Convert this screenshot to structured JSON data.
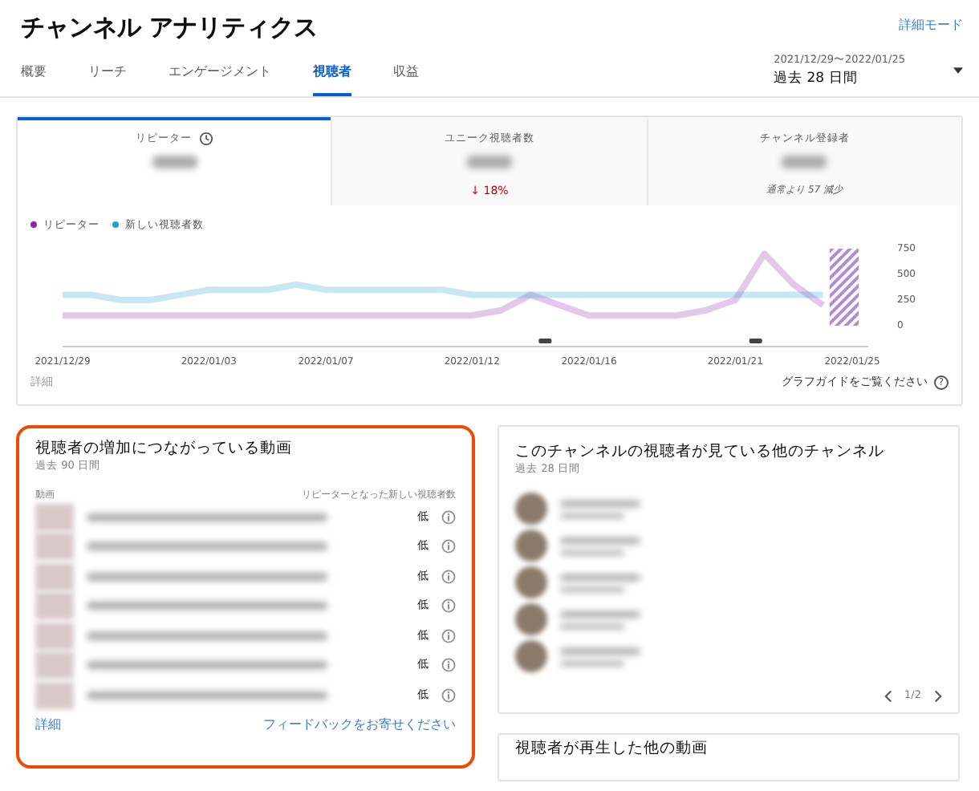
{
  "header": {
    "title": "チャンネル アナリティクス",
    "advanced_mode": "詳細モード"
  },
  "tabs": [
    {
      "label": "概要",
      "selected": false
    },
    {
      "label": "リーチ",
      "selected": false
    },
    {
      "label": "エンゲージメント",
      "selected": false
    },
    {
      "label": "視聴者",
      "selected": true
    },
    {
      "label": "収益",
      "selected": false
    }
  ],
  "date_range": {
    "range": "2021/12/29〜2022/01/25",
    "label": "過去 28 日間"
  },
  "metrics": [
    {
      "label": "リピーター",
      "selected": true,
      "kind": "info"
    },
    {
      "label": "ユニーク視聴者数",
      "selected": false,
      "kind": "change",
      "change": "↓ 18%"
    },
    {
      "label": "チャンネル登録者",
      "selected": false,
      "kind": "note",
      "note": "通常より 57 減少"
    }
  ],
  "chart": {
    "chart_data": {
      "type": "line",
      "categories": [
        "2021/12/29",
        null,
        null,
        null,
        null,
        "2022/01/03",
        null,
        null,
        null,
        "2022/01/07",
        null,
        null,
        null,
        null,
        "2022/01/12",
        null,
        null,
        null,
        "2022/01/16",
        null,
        null,
        null,
        null,
        "2022/01/21",
        null,
        null,
        null,
        "2022/01/25"
      ],
      "ylim": [
        0,
        750
      ],
      "yticks": [
        0,
        250,
        500,
        750
      ],
      "series": [
        {
          "name": "リピーター",
          "color": "#8e24aa",
          "values": [
            100,
            100,
            100,
            100,
            100,
            100,
            100,
            100,
            100,
            100,
            100,
            100,
            100,
            100,
            100,
            150,
            300,
            200,
            100,
            100,
            100,
            100,
            150,
            250,
            700,
            400,
            200,
            null
          ]
        },
        {
          "name": "新しい視聴者数",
          "color": "#1e9fd6",
          "values": [
            300,
            300,
            250,
            250,
            300,
            350,
            350,
            350,
            400,
            350,
            350,
            350,
            350,
            350,
            300,
            300,
            300,
            300,
            300,
            300,
            300,
            300,
            300,
            300,
            300,
            300,
            300,
            null
          ]
        }
      ]
    },
    "details_link": "詳細",
    "guide_link": "グラフガイドをご覧ください",
    "guide_icon": "?"
  },
  "growth_videos": {
    "title": "視聴者の増加につながっている動画",
    "subtitle": "過去 90 日間",
    "highlighted": true,
    "columns": [
      "動画",
      "リピーターとなった新しい視聴者数"
    ],
    "rows": [
      {
        "value": "低"
      },
      {
        "value": "低"
      },
      {
        "value": "低"
      },
      {
        "value": "低"
      },
      {
        "value": "低"
      },
      {
        "value": "低"
      },
      {
        "value": "低"
      }
    ],
    "details_link": "詳細",
    "feedback_link": "フィードバックをお寄せください"
  },
  "other_channels": {
    "title": "このチャンネルの視聴者が見ている他のチャンネル",
    "subtitle": "過去 28 日間",
    "page": "1/2"
  },
  "next_card": {
    "title": "視聴者が再生した他の動画"
  }
}
